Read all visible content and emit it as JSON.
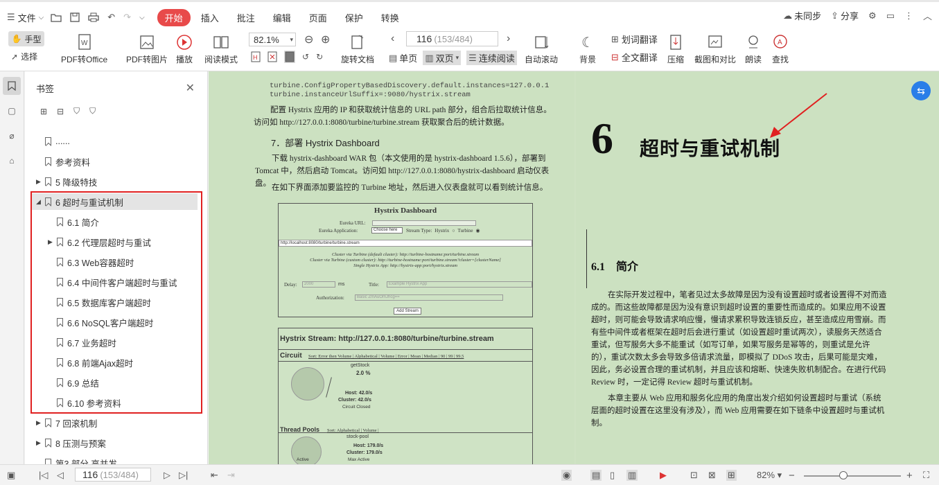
{
  "menubar": {
    "menu_label": "文件",
    "tabs": [
      "开始",
      "插入",
      "批注",
      "编辑",
      "页面",
      "保护",
      "转换"
    ],
    "sync_label": "未同步",
    "share_label": "分享"
  },
  "toolbar": {
    "hand_label": "手型",
    "select_label": "选择",
    "pdf_office": "PDF转Office",
    "pdf_image": "PDF转图片",
    "play": "播放",
    "read_mode": "阅读模式",
    "zoom_value": "82.1%",
    "rotate_doc": "旋转文档",
    "page_current": "116",
    "page_total": "(153/484)",
    "single_page": "单页",
    "double_page": "双页",
    "continuous": "连续阅读",
    "auto_scroll": "自动滚动",
    "background": "背景",
    "word_translate": "划词翻译",
    "full_translate": "全文翻译",
    "compress": "压缩",
    "screenshot_compare": "截图和对比",
    "read_aloud": "朗读",
    "find": "查找"
  },
  "sidebar": {
    "title": "书签",
    "items": [
      {
        "label": "......",
        "level": 0,
        "arrow": ""
      },
      {
        "label": "参考资料",
        "level": 0,
        "arrow": ""
      },
      {
        "label": "5 降级特技",
        "level": 0,
        "arrow": "▶"
      },
      {
        "label": "6 超时与重试机制",
        "level": 0,
        "arrow": "◢"
      },
      {
        "label": "6.1 简介",
        "level": 1,
        "arrow": ""
      },
      {
        "label": "6.2 代理层超时与重试",
        "level": 1,
        "arrow": "▶"
      },
      {
        "label": "6.3 Web容器超时",
        "level": 1,
        "arrow": ""
      },
      {
        "label": "6.4 中间件客户端超时与重试",
        "level": 1,
        "arrow": ""
      },
      {
        "label": "6.5 数据库客户端超时",
        "level": 1,
        "arrow": ""
      },
      {
        "label": "6.6 NoSQL客户端超时",
        "level": 1,
        "arrow": ""
      },
      {
        "label": "6.7 业务超时",
        "level": 1,
        "arrow": ""
      },
      {
        "label": "6.8 前端Ajax超时",
        "level": 1,
        "arrow": ""
      },
      {
        "label": "6.9 总结",
        "level": 1,
        "arrow": ""
      },
      {
        "label": "6.10 参考资料",
        "level": 1,
        "arrow": ""
      },
      {
        "label": "7 回滚机制",
        "level": 0,
        "arrow": "▶"
      },
      {
        "label": "8 压测与预案",
        "level": 0,
        "arrow": "▶"
      },
      {
        "label": "第3 部分 高并发",
        "level": 0,
        "arrow": ""
      }
    ]
  },
  "left_page": {
    "code_line1": "turbine.ConfigPropertyBasedDiscovery.default.instances=127.0.0.1",
    "code_line2": "turbine.instanceUrlSuffix=:9080/hystrix.stream",
    "para1": "配置 Hystrix 应用的 IP 和获取统计信息的 URL path 部分，组合后拉取统计信息。访问如 http://127.0.0.1:8080/turbine/turbine.stream 获取聚合后的统计数据。",
    "heading7": "7．部署 Hystrix Dashboard",
    "para2": "下载 hystrix-dashboard WAR 包（本文使用的是 hystrix-dashboard 1.5.6），部署到 Tomcat 中，然后启动 Tomcat。访问如 http://127.0.0.1:8080/hystrix-dashboard 启动仪表盘。",
    "para3": "在如下界面添加要监控的 Turbine 地址，然后进入仪表盘就可以看到统计信息。",
    "dashboard_title": "Hystrix Dashboard",
    "eureka_url_label": "Eureka URL:",
    "eureka_app_label": "Eureka Application:",
    "choose_here": "Choose here",
    "stream_type": "Stream Type:",
    "stream_hystrix": "Hystrix",
    "stream_turbine": "Turbine",
    "stream_input": "http://localhost:8080/turbine/turbine.stream",
    "cluster1": "Cluster via Turbine (default cluster): http://turbine-hostname:port/turbine.stream",
    "cluster2": "Cluster via Turbine (custom cluster): http://turbine-hostname:port/turbine.stream?cluster=[clusterName]",
    "single": "Single Hystrix App: http://hystrix-app:port/hystrix.stream",
    "delay_label": "Delay:",
    "delay_value": "2000",
    "ms": "ms",
    "title_label": "Title:",
    "title_placeholder": "Example Hystrix App",
    "auth_label": "Authorization:",
    "auth_placeholder": "Basic ZmAuOmJhcg==",
    "add_stream": "Add Stream",
    "stream_title": "Hystrix Stream: http://127.0.0.1:8080/turbine/turbine.stream",
    "circuit": "Circuit",
    "circuit_sort": "Sort: Error then Volume | Alphabetical | Volume | Error | Mean | Median | 90 | 99 | 99.5",
    "getstock": "getStock",
    "pct": "2.0 %",
    "host": "Host: 42.0/s",
    "cluster": "Cluster: 42.0/s",
    "circuit_closed": "Circuit Closed",
    "thread_pools": "Thread Pools",
    "tp_sort": "Sort: Alphabetical | Volume |",
    "stock_pool": "stock-pool",
    "tp_host": "Host: 179.0/s",
    "tp_cluster": "Cluster: 179.0/s",
    "active": "Active",
    "max_active": "Max Active"
  },
  "right_page": {
    "chapter_num": "6",
    "chapter_title": "超时与重试机制",
    "section": "6.1　简介",
    "para1": "在实际开发过程中，笔者见过太多故障是因为没有设置超时或者设置得不对而造成的。而这些故障都是因为没有意识到超时设置的重要性而造成的。如果应用不设置超时，则可能会导致请求响应慢，慢请求累积导致连锁反应，甚至造成应用雪崩。而有些中间件或者框架在超时后会进行重试（如设置超时重试两次），读服务天然适合重试，但写服务大多不能重试（如写订单，如果写服务是幂等的，则重试是允许的），重试次数太多会导致多倍请求流量，即模拟了 DDoS 攻击，后果可能是灾难，因此，务必设置合理的重试机制，并且应该和熔断、快速失败机制配合。在进行代码 Review 时，一定记得 Review 超时与重试机制。",
    "para2": "本章主要从 Web 应用和服务化应用的角度出发介绍如何设置超时与重试（系统层面的超时设置在这里没有涉及），而 Web 应用需要在如下链条中设置超时与重试机制。"
  },
  "statusbar": {
    "page_current": "116",
    "page_total": "(153/484)",
    "zoom": "82%"
  }
}
